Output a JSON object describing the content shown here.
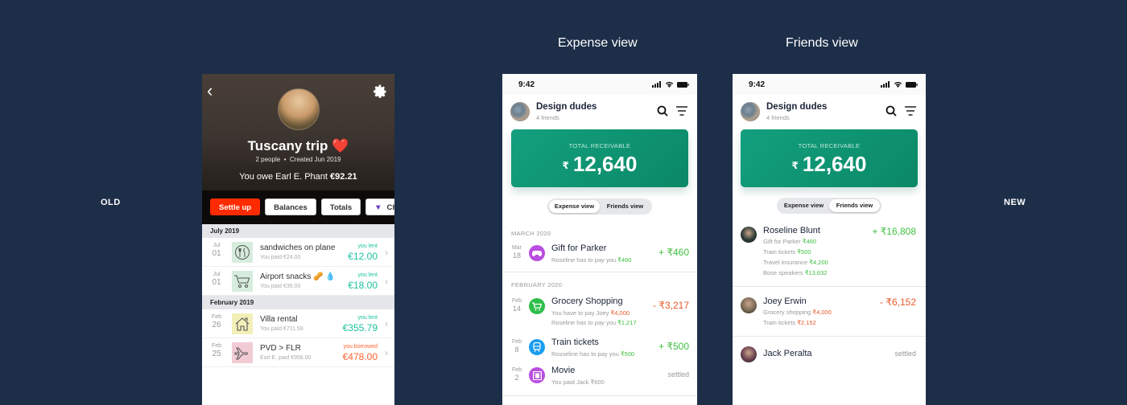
{
  "labels": {
    "old": "OLD",
    "new": "NEW",
    "expense_view_title": "Expense view",
    "friends_view_title": "Friends view"
  },
  "old_app": {
    "group_title": "Tuscany trip",
    "group_emoji": "❤️",
    "people": "2 people",
    "created": "Created Jun 2019",
    "owe_text": "You owe Earl E. Phant",
    "owe_amount": "€92.21",
    "buttons": [
      "Settle up",
      "Balances",
      "Totals",
      "Ch"
    ],
    "sections": [
      {
        "title": "July 2019",
        "items": [
          {
            "month": "Jul",
            "day": "01",
            "icon": "food-icon",
            "icon_bg": "#d6eddd",
            "name": "sandwiches on plane",
            "paid": "You paid €24.00",
            "label": "you lent",
            "amount": "€12.00",
            "type": "lent"
          },
          {
            "month": "Jul",
            "day": "01",
            "icon": "cart-icon",
            "icon_bg": "#d6eddd",
            "name": "Airport snacks 🥜 💧",
            "paid": "You paid €36.00",
            "label": "you lent",
            "amount": "€18.00",
            "type": "lent"
          }
        ]
      },
      {
        "title": "February 2019",
        "items": [
          {
            "month": "Feb",
            "day": "26",
            "icon": "house-icon",
            "icon_bg": "#f3efb8",
            "name": "Villa rental",
            "paid": "You paid €711.58",
            "label": "you lent",
            "amount": "€355.79",
            "type": "lent"
          },
          {
            "month": "Feb",
            "day": "25",
            "icon": "plane-icon",
            "icon_bg": "#f2ccd5",
            "name": "PVD > FLR",
            "paid": "Earl E. paid €956.00",
            "label": "you borrowed",
            "amount": "€478.00",
            "type": "borrowed"
          }
        ]
      }
    ]
  },
  "new_app": {
    "status_time": "9:42",
    "group_name": "Design dudes",
    "group_sub": "4 friends",
    "total_label": "TOTAL RECEIVABLE",
    "currency": "₹",
    "total_amount": "12,640",
    "segments": [
      "Expense view",
      "Friends view"
    ],
    "colors": {
      "accent": "#0f9474",
      "positive": "#3fbf3f",
      "negative": "#e85a2a"
    },
    "expense_sections": [
      {
        "title": "MARCH 2020",
        "items": [
          {
            "month": "Mar",
            "day": "18",
            "icon": "gamepad-icon",
            "icon_color": "#b94ee0",
            "name": "Gift for Parker",
            "lines": [
              {
                "text": "Roseline has to pay you ",
                "amt": "₹460",
                "tone": "green"
              }
            ],
            "amount": "+ ₹460",
            "tone": "green"
          }
        ]
      },
      {
        "title": "FEBRUARY 2020",
        "items": [
          {
            "month": "Feb",
            "day": "14",
            "icon": "cart-icon",
            "icon_color": "#2fbe4a",
            "name": "Grocery Shopping",
            "lines": [
              {
                "text": "You have to pay Joey ",
                "amt": "₹4,000",
                "tone": "red"
              },
              {
                "text": "Roseline has to pay you ",
                "amt": "₹1,217",
                "tone": "green"
              }
            ],
            "amount": "- ₹3,217",
            "tone": "red"
          },
          {
            "month": "Feb",
            "day": "8",
            "icon": "train-icon",
            "icon_color": "#1a9cf0",
            "name": "Train tickets",
            "lines": [
              {
                "text": "Rosseline has to pay you ",
                "amt": "₹500",
                "tone": "green"
              }
            ],
            "amount": "+ ₹500",
            "tone": "green"
          },
          {
            "month": "Feb",
            "day": "2",
            "icon": "film-icon",
            "icon_color": "#b94ee0",
            "name": "Movie",
            "lines": [
              {
                "text": "You paid Jack ₹600",
                "amt": "",
                "tone": "gray"
              }
            ],
            "amount": "settled",
            "tone": "gray"
          }
        ]
      }
    ],
    "friends": [
      {
        "name": "Roseline Blunt",
        "amount": "+ ₹16,808",
        "tone": "green",
        "avatar_color": "#2a3a36",
        "lines": [
          {
            "text": "Gift for Parker ",
            "amt": "₹460"
          },
          {
            "text": "Train tickets ",
            "amt": "₹500"
          },
          {
            "text": "Travel insurance ",
            "amt": "₹4,200"
          },
          {
            "text": "Bose speakers ",
            "amt": "₹13,632"
          }
        ]
      },
      {
        "name": "Joey Erwin",
        "amount": "- ₹6,152",
        "tone": "red",
        "avatar_color": "#7a6a55",
        "lines": [
          {
            "text": "Grocery shopping ",
            "amt": "₹4,000"
          },
          {
            "text": "Train tickets ",
            "amt": "₹2,152"
          }
        ]
      },
      {
        "name": "Jack Peralta",
        "amount": "settled",
        "tone": "gray",
        "avatar_color": "#6b4050",
        "lines": []
      }
    ]
  }
}
